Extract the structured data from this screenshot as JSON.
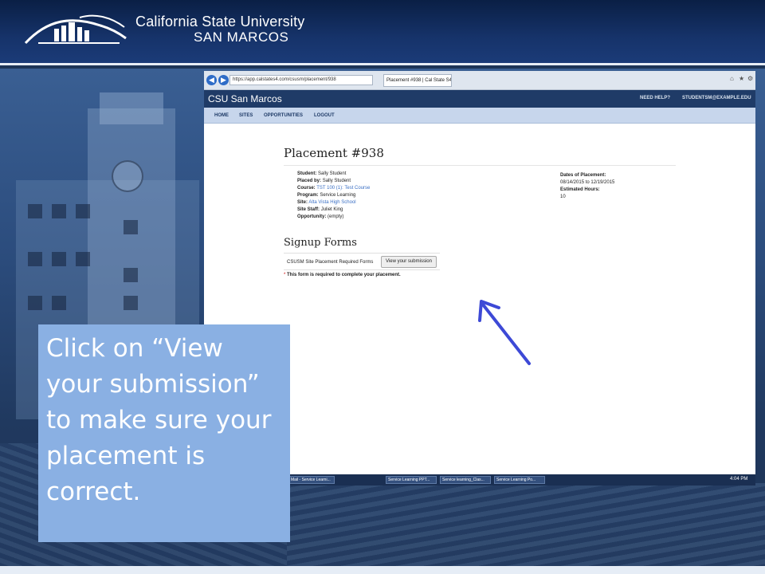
{
  "header": {
    "university_line1": "California State University",
    "university_line2": "SAN MARCOS"
  },
  "browser": {
    "url": "https://app.calstates4.com/csusm/placement/938",
    "tab_title": "Placement #938 | Cal State S4",
    "site": {
      "brand": "CSU San Marcos",
      "need_help": "NEED HELP?",
      "user_email": "STUDENTSM@EXAMPLE.EDU",
      "nav": [
        "HOME",
        "SITES",
        "OPPORTUNITIES",
        "LOGOUT"
      ]
    },
    "placement": {
      "title": "Placement #938",
      "student_label": "Student:",
      "student": "Sally Student",
      "placed_by_label": "Placed by:",
      "placed_by": "Sally Student",
      "course_label": "Course:",
      "course": "TST 100 (1): Test Course",
      "program_label": "Program:",
      "program": "Service Learning",
      "site_label": "Site:",
      "site": "Alta Vista High School",
      "site_staff_label": "Site Staff:",
      "site_staff": "Juliet King",
      "opportunity_label": "Opportunity:",
      "opportunity": "(empty)",
      "dates_label": "Dates of Placement:",
      "dates": "08/14/2015 to 12/19/2015",
      "hours_label": "Estimated Hours:",
      "hours": "10"
    },
    "signup": {
      "title": "Signup Forms",
      "form_name": "CSUSM Site Placement Required Forms",
      "button_label": "View your submission",
      "required_star": "*",
      "required_note": "This form is required to complete your placement."
    },
    "taskbar": {
      "items": [
        "Mail - Service Learni...",
        "Service Learning PPT...",
        "Service learning_Clas...",
        "Service Learning Po..."
      ],
      "time": "4:04 PM"
    }
  },
  "callout": {
    "text": "Click on “View your submission” to make sure your placement is correct."
  },
  "colors": {
    "header_bg": "#0f2a5c",
    "callout_bg": "#8ab0e3",
    "site_topbar": "#1f3b67",
    "site_nav": "#c7d6ec",
    "link": "#3a6fc4",
    "arrow": "#3d49d6"
  }
}
